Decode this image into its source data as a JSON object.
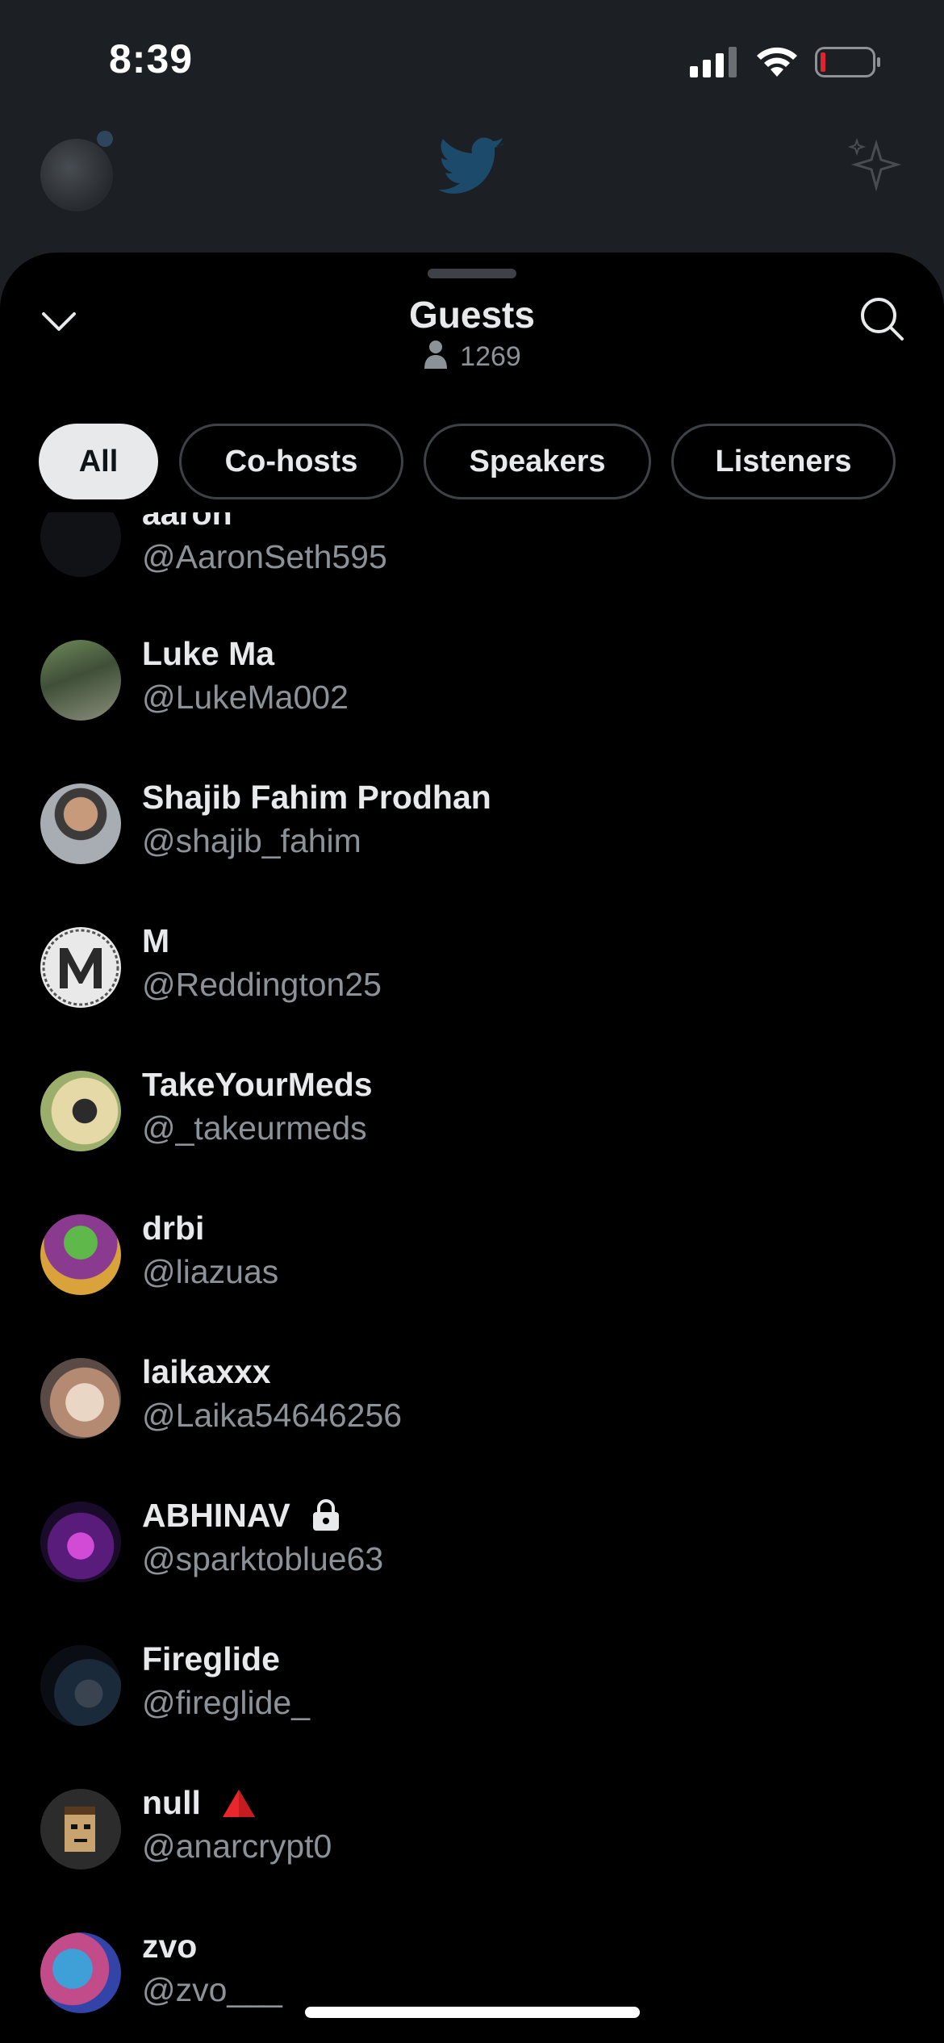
{
  "status_bar": {
    "time": "8:39",
    "battery_color": "#e0232e"
  },
  "background_header": {
    "logo": "twitter-bird-icon",
    "right_icon": "sparkle-icon"
  },
  "sheet": {
    "title": "Guests",
    "guest_count": "1269",
    "collapse_icon": "chevron-down-icon",
    "search_icon": "search-icon"
  },
  "tabs": [
    {
      "label": "All",
      "active": true
    },
    {
      "label": "Co-hosts",
      "active": false
    },
    {
      "label": "Speakers",
      "active": false
    },
    {
      "label": "Listeners",
      "active": false
    }
  ],
  "guests": [
    {
      "name": "aaron",
      "handle": "@AaronSeth595"
    },
    {
      "name": "Luke Ma",
      "handle": "@LukeMa002"
    },
    {
      "name": "Shajib Fahim Prodhan",
      "handle": "@shajib_fahim"
    },
    {
      "name": "M",
      "handle": "@Reddington25"
    },
    {
      "name": "TakeYourMeds",
      "handle": "@_takeurmeds"
    },
    {
      "name": "drbi",
      "handle": "@liazuas"
    },
    {
      "name": "laikaxxx",
      "handle": "@Laika54646256"
    },
    {
      "name": "ABHINAV",
      "handle": "@sparktoblue63",
      "badge": "lock-icon"
    },
    {
      "name": "Fireglide",
      "handle": "@fireglide_"
    },
    {
      "name": "null",
      "handle": "@anarcrypt0",
      "badge": "red-triangle-icon"
    },
    {
      "name": "zvo",
      "handle": "@zvo___"
    }
  ],
  "colors": {
    "sheet_bg": "#000000",
    "secondary_text": "#8b9298",
    "active_tab_bg": "#e7e9ea"
  }
}
